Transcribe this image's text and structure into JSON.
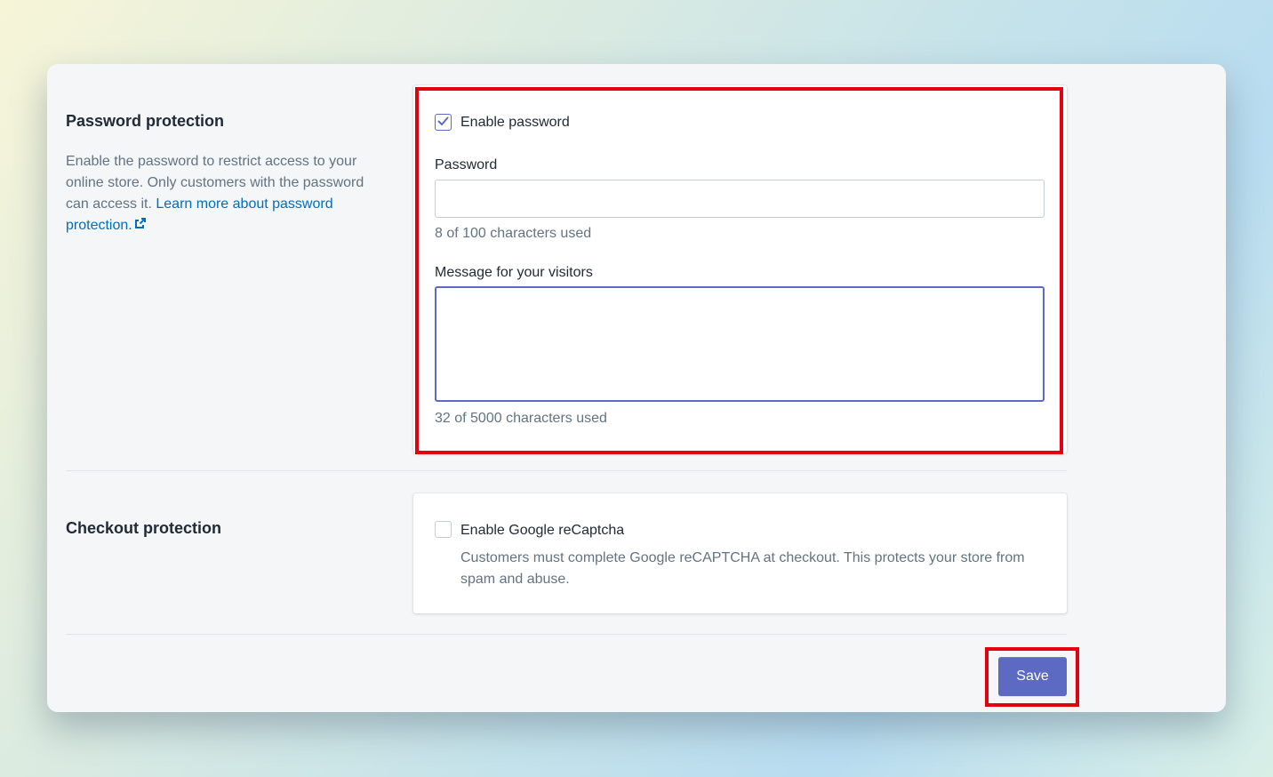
{
  "password_section": {
    "title": "Password protection",
    "description": "Enable the password to restrict access to your online store. Only customers with the password can access it. ",
    "learn_more_link": "Learn more about password protection.",
    "enable_checkbox_label": "Enable password",
    "enable_checked": true,
    "password_label": "Password",
    "password_value": "",
    "password_help": "8 of 100 characters used",
    "message_label": "Message for your visitors",
    "message_value": "",
    "message_help": "32 of 5000 characters used"
  },
  "checkout_section": {
    "title": "Checkout protection",
    "recaptcha_label": "Enable Google reCaptcha",
    "recaptcha_checked": false,
    "recaptcha_help": "Customers must complete Google reCAPTCHA at checkout. This protects your store from spam and abuse."
  },
  "footer": {
    "save_label": "Save"
  },
  "colors": {
    "accent": "#5c6ac4",
    "link": "#006fbb",
    "highlight": "#e3000f"
  },
  "icons": {
    "external_link": "external-link-icon",
    "checkmark": "checkmark-icon"
  }
}
